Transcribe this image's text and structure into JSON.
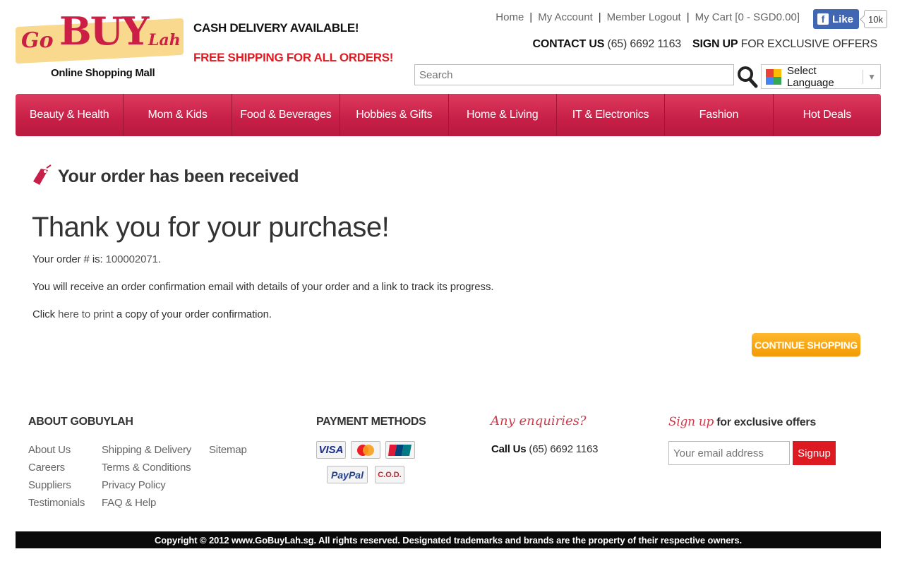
{
  "header": {
    "logo": {
      "go": "Go",
      "buy": "BUY",
      "lah": "Lah",
      "tagline": "Online Shopping Mall"
    },
    "promo_line1": "CASH DELIVERY AVAILABLE!",
    "promo_line2": "FREE SHIPPING FOR ALL ORDERS!",
    "top_links": {
      "home": "Home",
      "account": "My Account",
      "logout": "Member Logout",
      "cart": "My Cart [0 - SGD0.00]",
      "separator": "|"
    },
    "facebook": {
      "like": "Like",
      "count": "10k",
      "f": "f"
    },
    "contact": {
      "label": "CONTACT US",
      "phone": "(65) 6692 1163"
    },
    "signup_offer": {
      "label": "SIGN UP",
      "text": "FOR EXCLUSIVE OFFERS"
    },
    "search": {
      "placeholder": "Search"
    },
    "language": {
      "label": "Select Language",
      "arrow": "▼"
    }
  },
  "nav": [
    "Beauty & Health",
    "Mom & Kids",
    "Food & Beverages",
    "Hobbies & Gifts",
    "Home & Living",
    "IT & Electronics",
    "Fashion",
    "Hot Deals"
  ],
  "main": {
    "title": "Your order has been received",
    "thanks": "Thank you for your purchase!",
    "order_prefix": "Your order # is: ",
    "order_number": "100002071",
    "order_suffix": ".",
    "confirmation_text": "You will receive an order confirmation email with details of your order and a link to track its progress.",
    "click_text": "Click ",
    "here_link": "here to print",
    "print_text": " a copy of your order confirmation.",
    "continue_label": "CONTINUE SHOPPING"
  },
  "footer": {
    "about_heading": "ABOUT GOBUYLAH",
    "col1": [
      "About Us",
      "Careers",
      "Suppliers",
      "Testimonials"
    ],
    "col2": [
      "Shipping & Delivery",
      "Terms & Conditions",
      "Privacy Policy",
      "FAQ & Help"
    ],
    "col3": [
      "Sitemap"
    ],
    "payment_heading": "PAYMENT METHODS",
    "payments": {
      "visa": "VISA",
      "paypal": "PayPal",
      "cod": "C.O.D."
    },
    "enquiries": "Any enquiries?",
    "call_label": "Call Us",
    "call_phone": "(65) 6692 1163",
    "signup_script": "Sign up",
    "signup_text": " for exclusive offers",
    "email_placeholder": "Your email address",
    "signup_button": "Signup",
    "copyright": "Copyright © 2012 www.GoBuyLah.sg. All rights reserved. Designated trademarks and brands are the property of their respective owners."
  },
  "colors": {
    "brand": "#cc1f45",
    "accent": "#f29b05",
    "promo_red": "#e11b22"
  },
  "icons": {
    "search": "search-icon",
    "tag": "tag-icon",
    "globe": "google-icon"
  }
}
